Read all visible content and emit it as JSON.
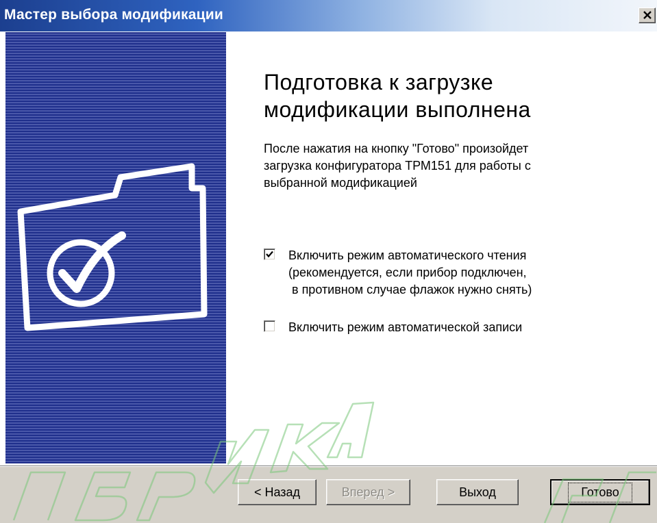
{
  "window": {
    "title": "Мастер выбора модификации"
  },
  "main": {
    "heading_line1": "Подготовка к загрузке",
    "heading_line2": "модификации выполнена",
    "desc_line1": "После нажатия на кнопку \"Готово\" произойдет",
    "desc_line2": "загрузка конфигуратора ТРМ151 для работы с",
    "desc_line3": "выбранной модификацией",
    "auto_read": {
      "checked": true,
      "line1": "Включить режим автоматического чтения",
      "line2": "(рекомендуется, если прибор подключен,",
      "line3": " в противном случае флажок нужно снять)"
    },
    "auto_write": {
      "checked": false,
      "line1": "Включить режим автоматической записи"
    }
  },
  "buttons": {
    "back": "< Назад",
    "next": "Вперед >",
    "exit": "Выход",
    "finish": "Готово"
  },
  "watermark": {
    "text": "ПРИБОРИКА"
  },
  "colors": {
    "sidebar_dark": "#1f2f8c",
    "sidebar_light": "#4a58aa",
    "button_face": "#d4d0c8",
    "watermark": "#7ac77a"
  },
  "icons": {
    "sidebar_graphic": "folder-check-icon",
    "close": "close-icon",
    "check": "checkmark-icon"
  }
}
